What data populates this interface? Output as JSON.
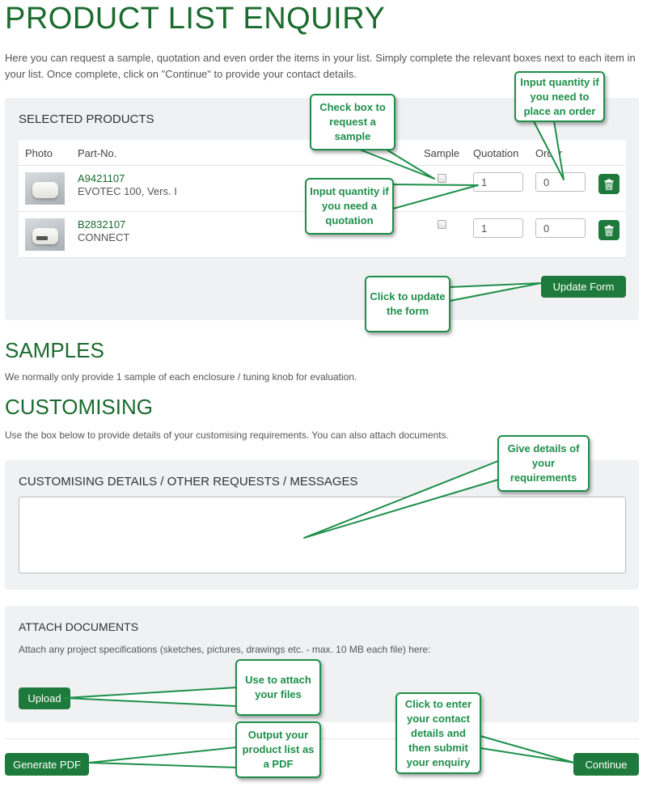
{
  "page": {
    "title": "PRODUCT LIST ENQUIRY",
    "intro": "Here you can request a sample, quotation and even order the items in your list. Simply complete the relevant boxes next to each item in your list. Once complete, click on \"Continue\" to provide your contact details."
  },
  "selected_products": {
    "heading": "SELECTED PRODUCTS",
    "columns": {
      "photo": "Photo",
      "part_no": "Part-No.",
      "sample": "Sample",
      "quotation": "Quotation",
      "order": "Order"
    },
    "rows": [
      {
        "part_no": "A9421107",
        "description": "EVOTEC 100, Vers. I",
        "sample_checked": false,
        "quotation": "1",
        "order": "0"
      },
      {
        "part_no": "B2832107",
        "description": "CONNECT",
        "sample_checked": false,
        "quotation": "1",
        "order": "0"
      }
    ],
    "update_button": "Update Form"
  },
  "samples": {
    "title": "SAMPLES",
    "text": "We normally only provide 1 sample of each enclosure / tuning knob for evaluation."
  },
  "customising": {
    "title": "CUSTOMISING",
    "text": "Use the box below to provide details of your customising requirements. You can also attach documents.",
    "panel_heading": "CUSTOMISING DETAILS / OTHER REQUESTS / MESSAGES",
    "textarea_value": ""
  },
  "attach": {
    "heading": "ATTACH DOCUMENTS",
    "text": "Attach any project specifications (sketches, pictures, drawings etc. - max. 10 MB each file) here:",
    "upload_button": "Upload"
  },
  "footer": {
    "generate_pdf_button": "Generate PDF",
    "continue_button": "Continue"
  },
  "callouts": {
    "sample": "Check box to request a sample",
    "order": "Input quantity if you need to place an order",
    "quotation": "Input quantity if you need a quotation",
    "update": "Click to update the form",
    "details": "Give details of your requirements",
    "upload": "Use to attach your files",
    "pdf": "Output your product list as a PDF",
    "continue": "Click to enter your contact details and then submit your enquiry"
  },
  "colors": {
    "brand_green": "#1e7a3c",
    "title_green": "#1a6b2e",
    "callout_green": "#1e8f4a",
    "panel_bg": "#f0f1f3"
  }
}
